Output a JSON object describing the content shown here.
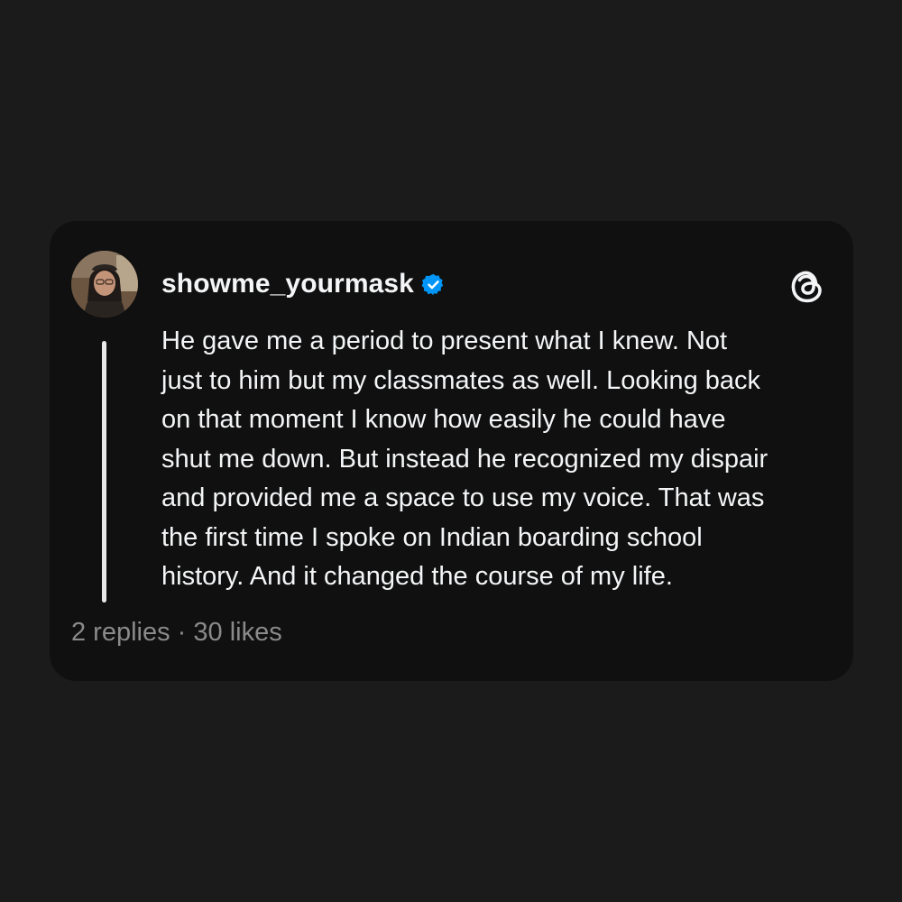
{
  "post": {
    "username": "showme_yourmask",
    "verified": true,
    "text": "He gave me a period to present what I knew. Not\njust to him but my classmates as well. Looking back\non that moment I know how easily he could have\nshut me down. But instead he recognized my dispair\nand provided me a space to use my voice. That was\nthe first time I spoke on Indian boarding school\nhistory. And it changed the course of my life.",
    "stats": "2 replies · 30 likes"
  },
  "icons": {
    "verified": "verified-badge-icon",
    "logo": "threads-logo-icon"
  },
  "colors": {
    "background": "#1b1b1b",
    "card": "#101010",
    "text": "#f3f5f7",
    "muted": "#8a8a8a",
    "verified": "#0095f6"
  }
}
